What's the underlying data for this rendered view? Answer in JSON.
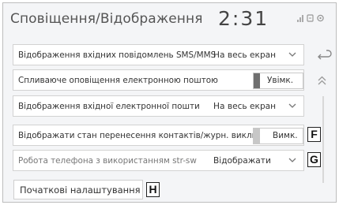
{
  "header": {
    "title": "Сповіщення/Відображення",
    "clock": "2:31"
  },
  "rows": [
    {
      "label": "Відображення вхідних повідомлень SMS/MMS",
      "value": "На весь екран"
    },
    {
      "label": "Спливаюче оповіщення електронною поштою",
      "toggle": "Увімк.",
      "toggle_on": true
    },
    {
      "label": "Відображення вхідної електронної пошти",
      "value": "На весь екран"
    },
    {
      "label": "Відображати стан перенесення контактів/журн. викликів",
      "toggle": "Вимк.",
      "toggle_on": false
    },
    {
      "label": "Робота телефона з використанням str-sw",
      "value": "Відображати"
    }
  ],
  "initial_settings_label": "Початкові налаштування",
  "callouts": {
    "f": "F",
    "g": "G",
    "h": "H"
  },
  "icons": {
    "back": "back-arrow-icon",
    "scroll_up": "double-chevron-up-icon",
    "dropdown": "chevron-down-icon",
    "signal": "signal-icon",
    "status1": "phone-status-icon",
    "status2": "bluetooth-status-icon"
  }
}
